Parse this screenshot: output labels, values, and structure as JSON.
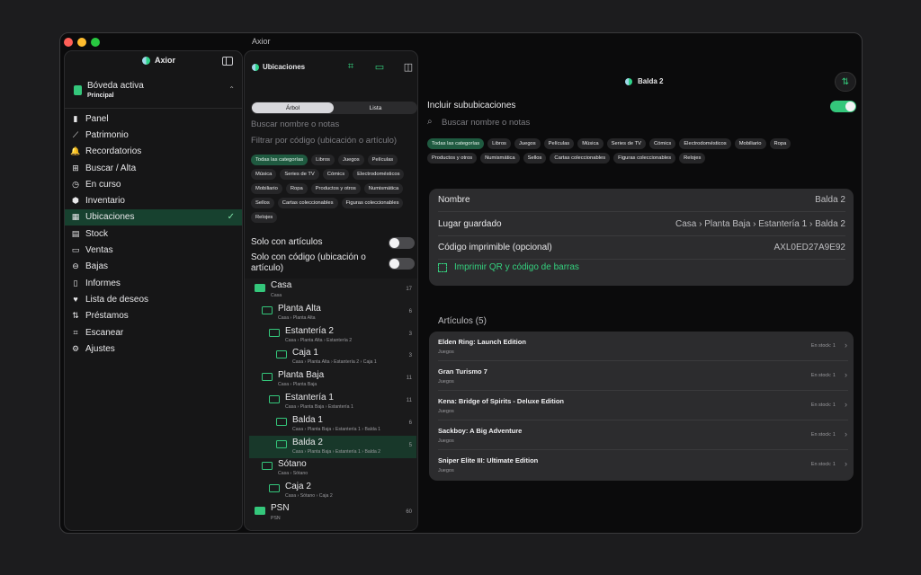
{
  "window": {
    "title": "Axior"
  },
  "sidebar": {
    "app_name": "Axior",
    "vault": {
      "title": "Bóveda activa",
      "subtitle": "Principal"
    },
    "items": [
      {
        "label": "Panel",
        "icon": "chart-bars-icon",
        "glyph": "▮"
      },
      {
        "label": "Patrimonio",
        "icon": "trend-line-icon",
        "glyph": "⟋"
      },
      {
        "label": "Recordatorios",
        "icon": "bell-icon",
        "glyph": "🔔"
      },
      {
        "label": "Buscar / Alta",
        "icon": "grid-icon",
        "glyph": "⊞"
      },
      {
        "label": "En curso",
        "icon": "clock-icon",
        "glyph": "◷"
      },
      {
        "label": "Inventario",
        "icon": "box-icon",
        "glyph": "⬢"
      },
      {
        "label": "Ubicaciones",
        "icon": "map-icon",
        "glyph": "▦"
      },
      {
        "label": "Stock",
        "icon": "archive-icon",
        "glyph": "▤"
      },
      {
        "label": "Ventas",
        "icon": "register-icon",
        "glyph": "▭"
      },
      {
        "label": "Bajas",
        "icon": "trash-icon",
        "glyph": "⊖"
      },
      {
        "label": "Informes",
        "icon": "document-icon",
        "glyph": "▯"
      },
      {
        "label": "Lista de deseos",
        "icon": "heart-icon",
        "glyph": "♥"
      },
      {
        "label": "Préstamos",
        "icon": "swap-icon",
        "glyph": "⇅"
      },
      {
        "label": "Escanear",
        "icon": "scan-icon",
        "glyph": "⌗"
      },
      {
        "label": "Ajustes",
        "icon": "gear-icon",
        "glyph": "⚙"
      }
    ],
    "active_index": 6
  },
  "middle": {
    "title": "Ubicaciones",
    "segments": [
      "Árbol",
      "Lista"
    ],
    "search_placeholder": "Buscar nombre o notas",
    "filter_placeholder": "Filtrar por código (ubicación o artículo)",
    "categories": [
      "Todas las categorías",
      "Libros",
      "Juegos",
      "Películas",
      "Música",
      "Series de TV",
      "Cómics",
      "Electrodomésticos",
      "Mobiliario",
      "Ropa",
      "Productos y otros",
      "Numismática",
      "Sellos",
      "Cartas coleccionables",
      "Figuras coleccionables",
      "Relojes"
    ],
    "toggle_items": "Solo con artículos",
    "toggle_code": "Solo con código (ubicación o artículo)",
    "tree": [
      {
        "name": "Casa",
        "path": "Casa",
        "count": "17",
        "level": 0,
        "filled": true
      },
      {
        "name": "Planta Alta",
        "path": "Casa › Planta Alta",
        "count": "6",
        "level": 1
      },
      {
        "name": "Estantería 2",
        "path": "Casa › Planta Alta › Estantería 2",
        "count": "3",
        "level": 2
      },
      {
        "name": "Caja 1",
        "path": "Casa › Planta Alta › Estantería 2 › Caja 1",
        "count": "3",
        "level": 3
      },
      {
        "name": "Planta Baja",
        "path": "Casa › Planta Baja",
        "count": "11",
        "level": 1
      },
      {
        "name": "Estantería 1",
        "path": "Casa › Planta Baja › Estantería 1",
        "count": "11",
        "level": 2
      },
      {
        "name": "Balda 1",
        "path": "Casa › Planta Baja › Estantería 1 › Balda 1",
        "count": "6",
        "level": 3
      },
      {
        "name": "Balda 2",
        "path": "Casa › Planta Baja › Estantería 1 › Balda 2",
        "count": "5",
        "level": 3,
        "selected": true
      },
      {
        "name": "Sótano",
        "path": "Casa › Sótano",
        "count": "",
        "level": 1
      },
      {
        "name": "Caja 2",
        "path": "Casa › Sótano › Caja 2",
        "count": "",
        "level": 2
      },
      {
        "name": "PSN",
        "path": "PSN",
        "count": "60",
        "level": 0,
        "filled": true
      }
    ]
  },
  "detail": {
    "title": "Balda 2",
    "include_sub": "Incluir sububicaciones",
    "search_placeholder": "Buscar nombre o notas",
    "categories": [
      "Todas las categorías",
      "Libros",
      "Juegos",
      "Películas",
      "Música",
      "Series de TV",
      "Cómics",
      "Electrodomésticos",
      "Mobiliario",
      "Ropa",
      "Productos y otros",
      "Numismática",
      "Sellos",
      "Cartas coleccionables",
      "Figuras coleccionables",
      "Relojes"
    ],
    "fields": [
      {
        "key": "Nombre",
        "value": "Balda 2"
      },
      {
        "key": "Lugar guardado",
        "value": "Casa › Planta Baja › Estantería 1 › Balda 2"
      },
      {
        "key": "Código imprimible (opcional)",
        "value": "AXL0ED27A9E92"
      }
    ],
    "print_label": "Imprimir QR y código de barras",
    "articles_label": "Artículos (5)",
    "articles": [
      {
        "name": "Elden Ring: Launch Edition",
        "category": "Juegos",
        "stock": "En stock: 1"
      },
      {
        "name": "Gran Turismo 7",
        "category": "Juegos",
        "stock": "En stock: 1"
      },
      {
        "name": "Kena: Bridge of Spirits - Deluxe Edition",
        "category": "Juegos",
        "stock": "En stock: 1"
      },
      {
        "name": "Sackboy: A Big Adventure",
        "category": "Juegos",
        "stock": "En stock: 1"
      },
      {
        "name": "Sniper Elite III: Ultimate Edition",
        "category": "Juegos",
        "stock": "En stock: 1"
      }
    ]
  }
}
